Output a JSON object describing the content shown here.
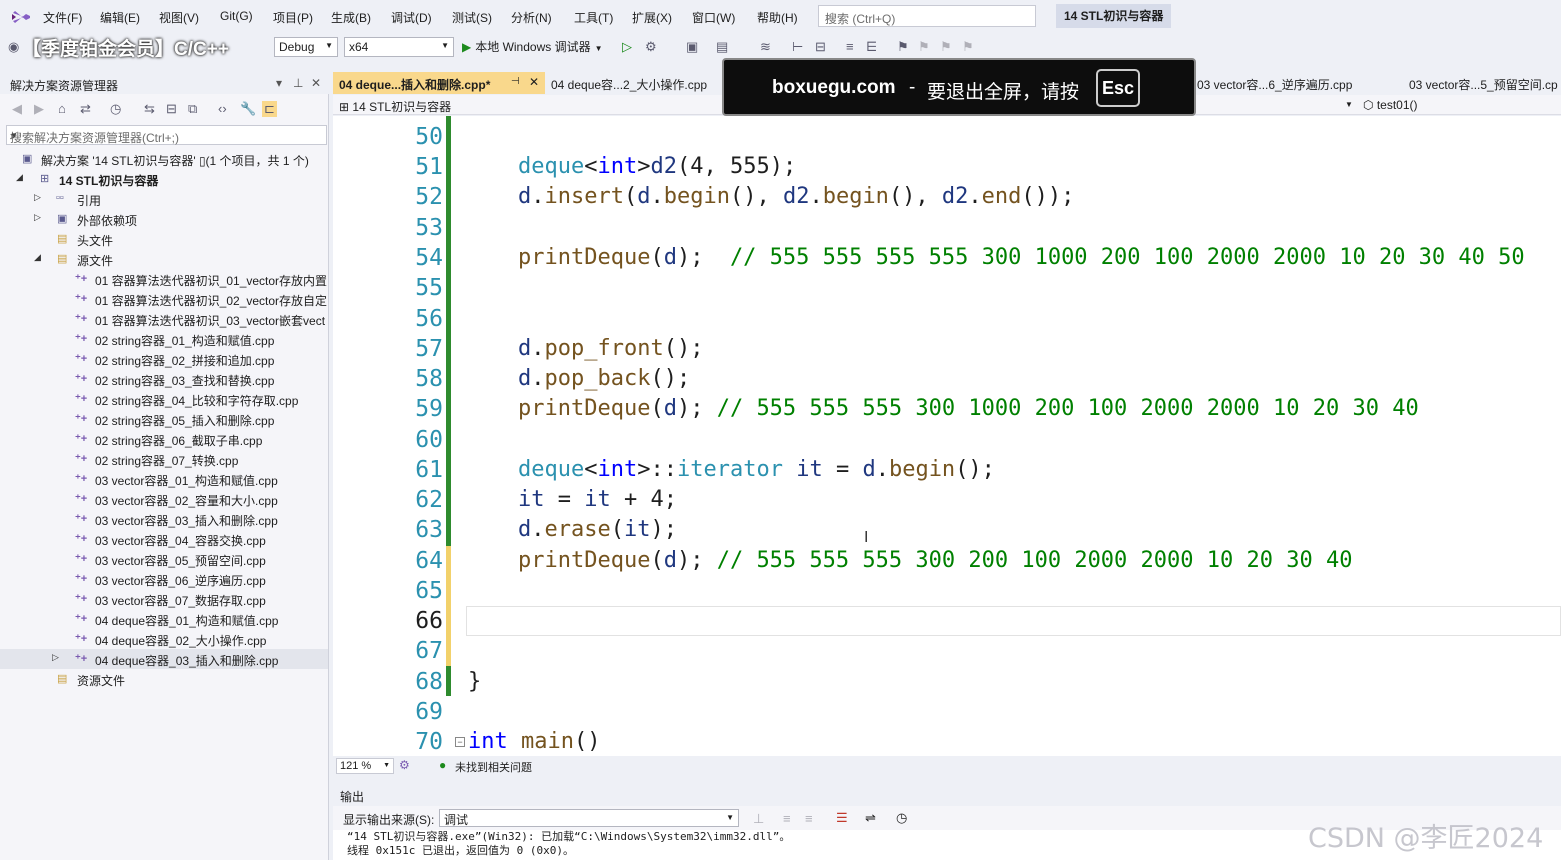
{
  "menu": [
    "文件(F)",
    "编辑(E)",
    "视图(V)",
    "Git(G)",
    "项目(P)",
    "生成(B)",
    "调试(D)",
    "测试(S)",
    "分析(N)",
    "工具(T)",
    "扩展(X)",
    "窗口(W)",
    "帮助(H)"
  ],
  "search": {
    "placeholder": "搜索 (Ctrl+Q)"
  },
  "solution_badge": "14 STL初识与容器",
  "toolbar": {
    "promo": "【季度铂金会员】C/C++",
    "config": "Debug",
    "platform": "x64",
    "run_label": "本地 Windows 调试器"
  },
  "solution_explorer": {
    "title": "解决方案资源管理器",
    "search_placeholder": "搜索解决方案资源管理器(Ctrl+;)",
    "items": [
      {
        "label": "解决方案 '14 STL初识与容器' ▯(1 个项目，共 1 个)",
        "depth": 0
      },
      {
        "label": "14 STL初识与容器",
        "depth": 1,
        "bold": true
      },
      {
        "label": "引用",
        "depth": 2
      },
      {
        "label": "外部依赖项",
        "depth": 2
      },
      {
        "label": "头文件",
        "depth": 2
      },
      {
        "label": "源文件",
        "depth": 2
      },
      {
        "label": "01 容器算法迭代器初识_01_vector存放内置",
        "depth": 3
      },
      {
        "label": "01 容器算法迭代器初识_02_vector存放自定",
        "depth": 3
      },
      {
        "label": "01 容器算法迭代器初识_03_vector嵌套vect",
        "depth": 3
      },
      {
        "label": "02 string容器_01_构造和赋值.cpp",
        "depth": 3
      },
      {
        "label": "02 string容器_02_拼接和追加.cpp",
        "depth": 3
      },
      {
        "label": "02 string容器_03_查找和替换.cpp",
        "depth": 3
      },
      {
        "label": "02 string容器_04_比较和字符存取.cpp",
        "depth": 3
      },
      {
        "label": "02 string容器_05_插入和删除.cpp",
        "depth": 3
      },
      {
        "label": "02 string容器_06_截取子串.cpp",
        "depth": 3
      },
      {
        "label": "02 string容器_07_转换.cpp",
        "depth": 3
      },
      {
        "label": "03 vector容器_01_构造和赋值.cpp",
        "depth": 3
      },
      {
        "label": "03 vector容器_02_容量和大小.cpp",
        "depth": 3
      },
      {
        "label": "03 vector容器_03_插入和删除.cpp",
        "depth": 3
      },
      {
        "label": "03 vector容器_04_容器交换.cpp",
        "depth": 3
      },
      {
        "label": "03 vector容器_05_预留空间.cpp",
        "depth": 3
      },
      {
        "label": "03 vector容器_06_逆序遍历.cpp",
        "depth": 3
      },
      {
        "label": "03 vector容器_07_数据存取.cpp",
        "depth": 3
      },
      {
        "label": "04 deque容器_01_构造和赋值.cpp",
        "depth": 3
      },
      {
        "label": "04 deque容器_02_大小操作.cpp",
        "depth": 3
      },
      {
        "label": "04 deque容器_03_插入和删除.cpp",
        "depth": 3,
        "selected": true
      },
      {
        "label": "资源文件",
        "depth": 2
      }
    ]
  },
  "tabs": [
    {
      "label": "04 deque...插入和删除.cpp*",
      "active": true
    },
    {
      "label": "04 deque容...2_大小操作.cpp"
    },
    {
      "label": "03 vector容...6_逆序遍历.cpp"
    },
    {
      "label": "03 vector容...5_预留空间.cp"
    }
  ],
  "navbar": {
    "project": "14 STL初识与容器",
    "function": "test01()"
  },
  "editor": {
    "line_numbers": [
      "50",
      "51",
      "52",
      "53",
      "54",
      "55",
      "56",
      "57",
      "58",
      "59",
      "60",
      "61",
      "62",
      "63",
      "64",
      "65",
      "66",
      "67",
      "68",
      "69",
      "70"
    ],
    "zoom": "121 %",
    "issues": "未找到相关问题"
  },
  "output": {
    "title": "输出",
    "source_label": "显示输出来源(S):",
    "source_value": "调试",
    "lines": [
      "“14 STL初识与容器.exe”(Win32): 已加载“C:\\Windows\\System32\\imm32.dll”。",
      "线程 0x151c 已退出，返回值为 0 (0x0)。"
    ]
  },
  "overlay": {
    "domain": "boxuegu.com",
    "sep": "-",
    "message": "要退出全屏，请按",
    "key": "Esc"
  },
  "watermark": "CSDN @李匠2024"
}
